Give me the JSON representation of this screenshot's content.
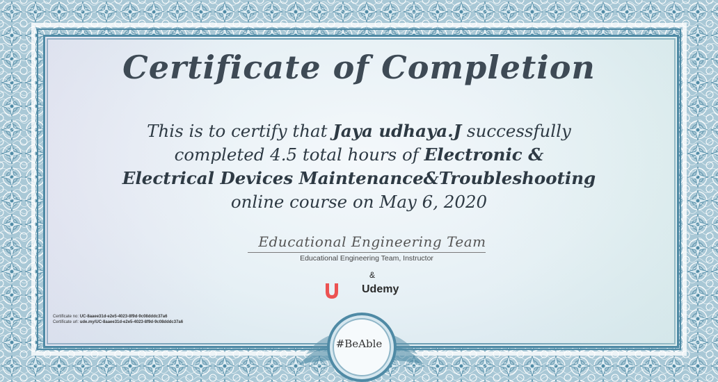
{
  "certificate": {
    "title": "Certificate of Completion",
    "line1_prefix": "This is to certify that ",
    "recipient": "Jaya udhaya.J",
    "line1_suffix": " successfully",
    "line2_prefix": "completed 4.5 total hours of ",
    "course_part1": "Electronic &",
    "course_part2": "Electrical Devices Maintenance&Troubleshooting",
    "line4": "online course on May 6, 2020",
    "signature": "Educational Engineering Team",
    "instructor": "Educational Engineering Team, Instructor",
    "ampersand": "&",
    "platform": "Udemy",
    "cert_no_label": "Certificate no: ",
    "cert_no": "UC-8aaee31d-e2e5-4023-8f9d-9c08dddc37a6",
    "cert_url_label": "Certificate url: ",
    "cert_url": "ude.my/UC-8aaee31d-e2e5-4023-8f9d-9c08dddc37a6",
    "seal_text": "#BeAble"
  },
  "colors": {
    "border": "#8fb6c8",
    "frame": "#4f8aa5",
    "udemy_red": "#ec5252",
    "text": "#2e3a44"
  }
}
